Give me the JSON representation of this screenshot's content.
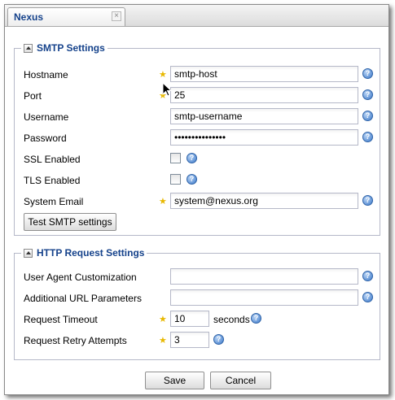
{
  "tab": {
    "title": "Nexus",
    "close_glyph": "×"
  },
  "smtp": {
    "legend": "SMTP Settings",
    "hostname": {
      "label": "Hostname",
      "value": "smtp-host",
      "required": true
    },
    "port": {
      "label": "Port",
      "value": "25",
      "required": true
    },
    "username": {
      "label": "Username",
      "value": "smtp-username",
      "required": false
    },
    "password": {
      "label": "Password",
      "value": "•••••••••••••••",
      "required": false
    },
    "ssl": {
      "label": "SSL Enabled",
      "checked": false
    },
    "tls": {
      "label": "TLS Enabled",
      "checked": false
    },
    "system_email": {
      "label": "System Email",
      "value": "system@nexus.org",
      "required": true
    },
    "test_button": "Test SMTP settings"
  },
  "http": {
    "legend": "HTTP Request Settings",
    "user_agent": {
      "label": "User Agent Customization",
      "value": ""
    },
    "url_params": {
      "label": "Additional URL Parameters",
      "value": ""
    },
    "timeout": {
      "label": "Request Timeout",
      "value": "10",
      "suffix": "seconds",
      "required": true
    },
    "retry": {
      "label": "Request Retry Attempts",
      "value": "3",
      "required": true
    }
  },
  "footer": {
    "save": "Save",
    "cancel": "Cancel"
  },
  "icons": {
    "help": "?",
    "required_star": "★"
  },
  "colors": {
    "legend": "#15428b",
    "required_star": "#e8b800",
    "help": "#3a78c9"
  }
}
